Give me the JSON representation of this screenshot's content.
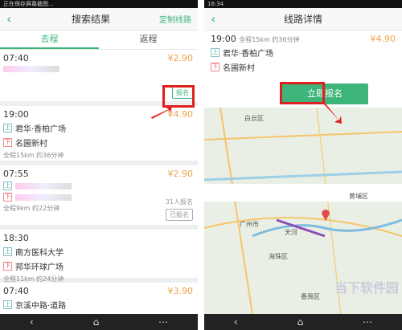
{
  "left": {
    "status_text": "正在保存屏幕截图...",
    "title": "搜索结果",
    "custom_route": "定制线路",
    "tabs": [
      "去程",
      "返程"
    ],
    "routes": [
      {
        "time": "07:40",
        "price": "¥2.90",
        "apply": "报名"
      },
      {
        "time": "19:00",
        "price": "¥4.90",
        "from": "君华·香柏广场",
        "to": "名圃新村",
        "meta": "全程15km  约36分钟"
      },
      {
        "time": "07:55",
        "price": "¥2.90",
        "meta": "全程9km  约22分钟",
        "count": "31人报名",
        "state": "已报名"
      },
      {
        "time": "18:30",
        "from": "南方医科大学",
        "to": "邦华环球广场",
        "meta": "全程11km  约24分钟"
      },
      {
        "time": "07:40",
        "price": "¥3.90",
        "from": "京溪中路·道路"
      }
    ],
    "tag_up": "上",
    "tag_down": "下"
  },
  "right": {
    "status_time": "16:34",
    "title": "线路详情",
    "time": "19:00",
    "meta": "全程15km  约36分钟",
    "price": "¥4.90",
    "from": "君华·香柏广场",
    "to": "名圃新村",
    "join_button": "立即报名",
    "map_labels": [
      "广州市",
      "白云区",
      "黄埔区",
      "番禺区",
      "天河",
      "海珠区"
    ],
    "watermark": "当下软件园"
  },
  "nav": {
    "back": "‹",
    "home": "⌂",
    "menu": "⋯"
  }
}
